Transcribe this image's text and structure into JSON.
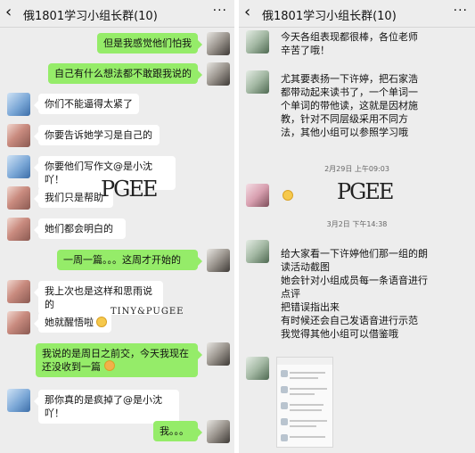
{
  "left": {
    "title": "俄1801学习小组长群(10)",
    "messages": [
      {
        "side": "out",
        "text": "但是我感觉他们怕我"
      },
      {
        "side": "out",
        "text": "自己有什么想法都不敢跟我说的"
      },
      {
        "side": "in",
        "text": "你们不能逼得太紧了"
      },
      {
        "side": "in",
        "text": "你要告诉她学习是自己的"
      },
      {
        "side": "in",
        "text": "你要他们写作文@是小沈吖！"
      },
      {
        "side": "in",
        "text": "我们只是帮助"
      },
      {
        "side": "in",
        "text": "她们都会明白的"
      },
      {
        "side": "out",
        "text": "一周一篇。。。这周才开始的"
      },
      {
        "side": "in",
        "text": "我上次也是这样和思雨说的"
      },
      {
        "side": "in",
        "text": "她就醒悟啦"
      },
      {
        "side": "out",
        "text": "我说的是周日之前交，今天我现在还没收到一篇"
      },
      {
        "side": "in",
        "text": "那你真的是疯掉了@是小沈吖！"
      },
      {
        "side": "out",
        "text": "我。。。"
      }
    ],
    "watermark_small": "TINY&PUGEE"
  },
  "right": {
    "title": "俄1801学习小组长群(10)",
    "msg1": "今天各组表现都很棒，各位老师辛苦了哦！",
    "msg2": "尤其要表扬一下许婷，把石家浩都带动起来读书了，一个单词一个单词的带他读，这就是因材施教，针对不同层级采用不同方法，其他小组可以参照学习哦",
    "time1": "2月29日 上午09:03",
    "time2": "3月2日 下午14:38",
    "msg3": "给大家看一下许婷他们那一组的朗读活动截图\n她会针对小组成员每一条语音进行点评\n把错误指出来\n有时候还会自己发语音进行示范\n我觉得其他小组可以借鉴哦"
  },
  "colors": {
    "background": "#ededed",
    "outgoing_bubble": "#95ec69",
    "incoming_bubble": "#ffffff"
  },
  "icons": [
    "back-arrow-icon",
    "more-icon",
    "smiley-emoji-icon",
    "shame-emoji-icon"
  ]
}
